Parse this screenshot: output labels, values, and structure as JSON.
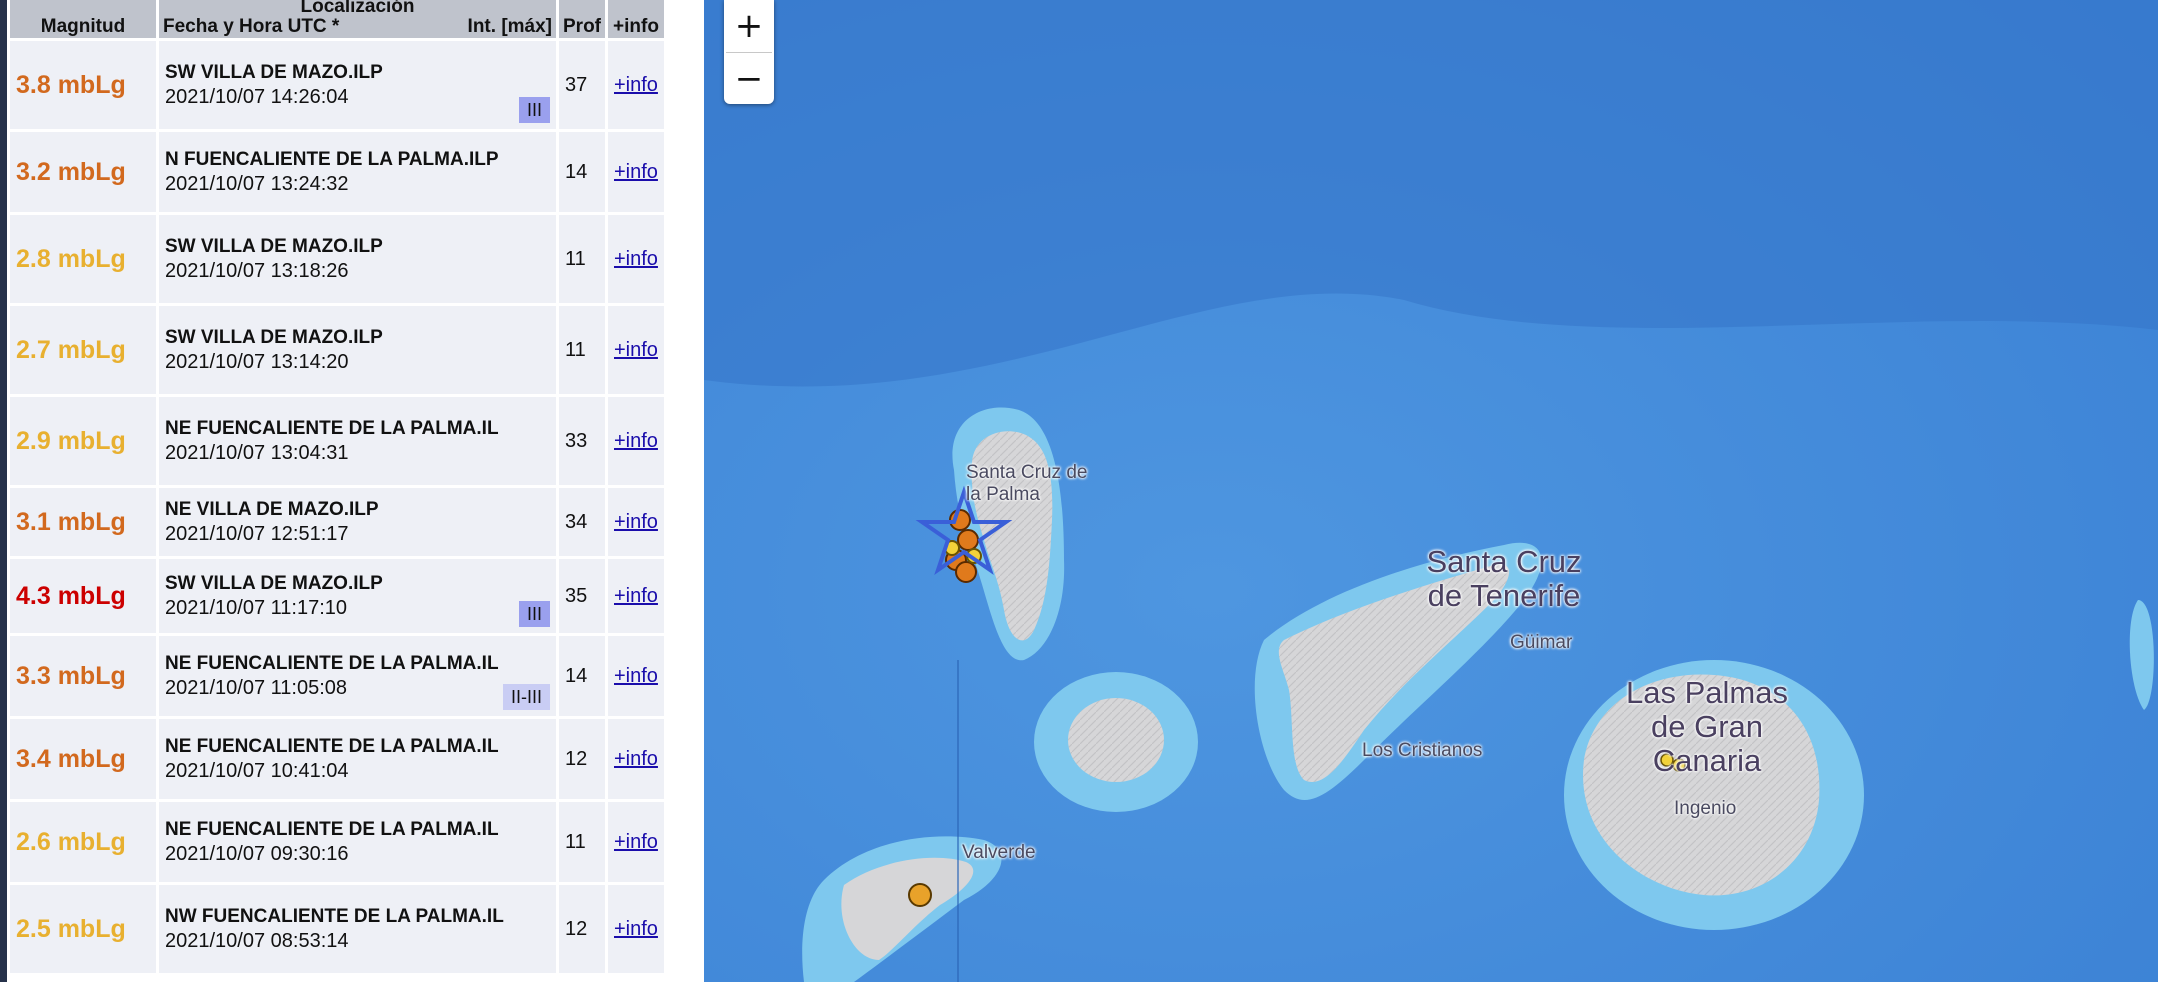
{
  "table": {
    "headers": {
      "magnitude": "Magnitud",
      "location_top": "Localización",
      "datetime": "Fecha y Hora UTC *",
      "intensity": "Int. [máx]",
      "depth": "Prof",
      "info": "+info"
    },
    "rows": [
      {
        "mag": "3.8 mbLg",
        "mag_color": "#d2691e",
        "place": "SW VILLA DE MAZO.ILP",
        "date": "2021/10/07 14:26:04",
        "intensity": "III",
        "depth": "37",
        "info": "+info"
      },
      {
        "mag": "3.2 mbLg",
        "mag_color": "#d2691e",
        "place": "N FUENCALIENTE DE LA PALMA.ILP",
        "date": "2021/10/07 13:24:32",
        "intensity": "",
        "depth": "14",
        "info": "+info"
      },
      {
        "mag": "2.8 mbLg",
        "mag_color": "#e8b030",
        "place": "SW VILLA DE MAZO.ILP",
        "date": "2021/10/07 13:18:26",
        "intensity": "",
        "depth": "11",
        "info": "+info"
      },
      {
        "mag": "2.7 mbLg",
        "mag_color": "#e8b030",
        "place": "SW VILLA DE MAZO.ILP",
        "date": "2021/10/07 13:14:20",
        "intensity": "",
        "depth": "11",
        "info": "+info"
      },
      {
        "mag": "2.9 mbLg",
        "mag_color": "#e8b030",
        "place": "NE FUENCALIENTE DE LA PALMA.IL",
        "date": "2021/10/07 13:04:31",
        "intensity": "",
        "depth": "33",
        "info": "+info"
      },
      {
        "mag": "3.1 mbLg",
        "mag_color": "#d2691e",
        "place": "NE VILLA DE MAZO.ILP",
        "date": "2021/10/07 12:51:17",
        "intensity": "",
        "depth": "34",
        "info": "+info"
      },
      {
        "mag": "4.3 mbLg",
        "mag_color": "#cc0000",
        "place": "SW VILLA DE MAZO.ILP",
        "date": "2021/10/07 11:17:10",
        "intensity": "III",
        "depth": "35",
        "info": "+info"
      },
      {
        "mag": "3.3 mbLg",
        "mag_color": "#d2691e",
        "place": "NE FUENCALIENTE DE LA PALMA.IL",
        "date": "2021/10/07 11:05:08",
        "intensity": "II-III",
        "depth": "14",
        "info": "+info"
      },
      {
        "mag": "3.4 mbLg",
        "mag_color": "#d2691e",
        "place": "NE FUENCALIENTE DE LA PALMA.IL",
        "date": "2021/10/07 10:41:04",
        "intensity": "",
        "depth": "12",
        "info": "+info"
      },
      {
        "mag": "2.6 mbLg",
        "mag_color": "#e8b030",
        "place": "NE FUENCALIENTE DE LA PALMA.IL",
        "date": "2021/10/07 09:30:16",
        "intensity": "",
        "depth": "11",
        "info": "+info"
      },
      {
        "mag": "2.5 mbLg",
        "mag_color": "#e8b030",
        "place": "NW FUENCALIENTE DE LA PALMA.IL",
        "date": "2021/10/07 08:53:14",
        "intensity": "",
        "depth": "12",
        "info": "+info"
      }
    ]
  },
  "map": {
    "zoom_in": "+",
    "zoom_out": "−",
    "labels": {
      "santa_cruz_palma": "Santa Cruz de la Palma",
      "santa_cruz_tenerife_l1": "Santa Cruz",
      "santa_cruz_tenerife_l2": "de Tenerife",
      "guimar": "Güimar",
      "los_cristianos": "Los Cristianos",
      "las_palmas_l1": "Las Palmas",
      "las_palmas_l2": "de Gran",
      "las_palmas_l3": "Canaria",
      "ingenio": "Ingenio",
      "valverde": "Valverde"
    },
    "colors": {
      "ocean_deep": "#3f86d9",
      "ocean_shelf": "#7ec8ee",
      "land": "#d6d6d8",
      "marker_orange": "#e07a1c",
      "marker_yellow": "#f2d23a",
      "star_outline": "#3a5fd8"
    }
  }
}
